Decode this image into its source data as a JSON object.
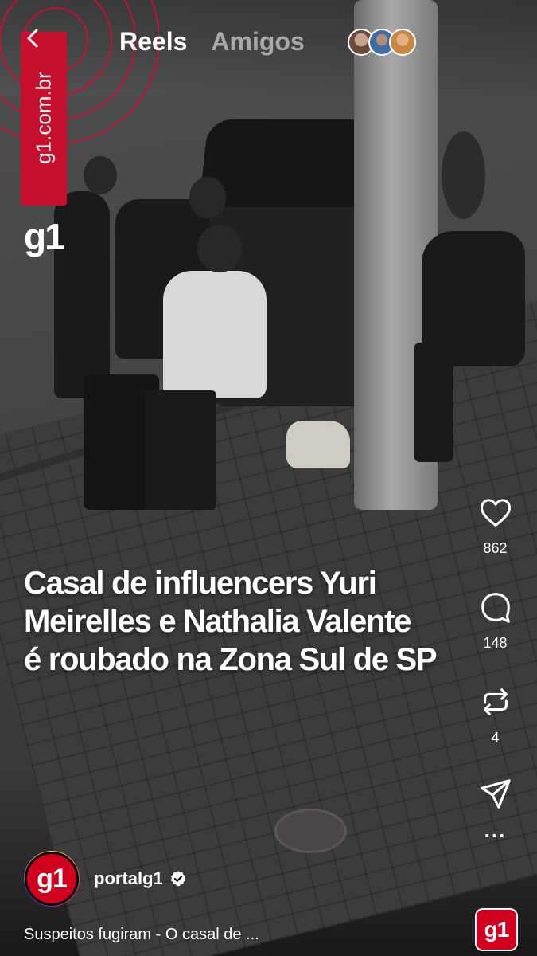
{
  "header": {
    "back_icon": "chevron-left-icon",
    "tabs": [
      {
        "label": "Reels",
        "active": true
      },
      {
        "label": "Amigos",
        "active": false
      }
    ],
    "friend_avatars": 3
  },
  "video": {
    "brand_vertical": "g1.com.br",
    "brand_logo": "g1",
    "headline_lines": [
      "Casal de influencers Yuri",
      "Meirelles e Nathalia Valente",
      "é roubado na Zona Sul de SP"
    ],
    "brand_color": "#c8102e"
  },
  "actions": {
    "like": {
      "icon": "heart-icon",
      "count": "862"
    },
    "comment": {
      "icon": "comment-icon",
      "count": "148"
    },
    "repost": {
      "icon": "repost-icon",
      "count": "4"
    },
    "share": {
      "icon": "send-icon"
    },
    "more": {
      "icon": "more-icon",
      "label": "..."
    }
  },
  "author": {
    "handle": "portalg1",
    "avatar_text": "g1",
    "verified": true
  },
  "caption": "Suspeitos fugiram - O casal de ...",
  "audio": {
    "label": "g1"
  }
}
